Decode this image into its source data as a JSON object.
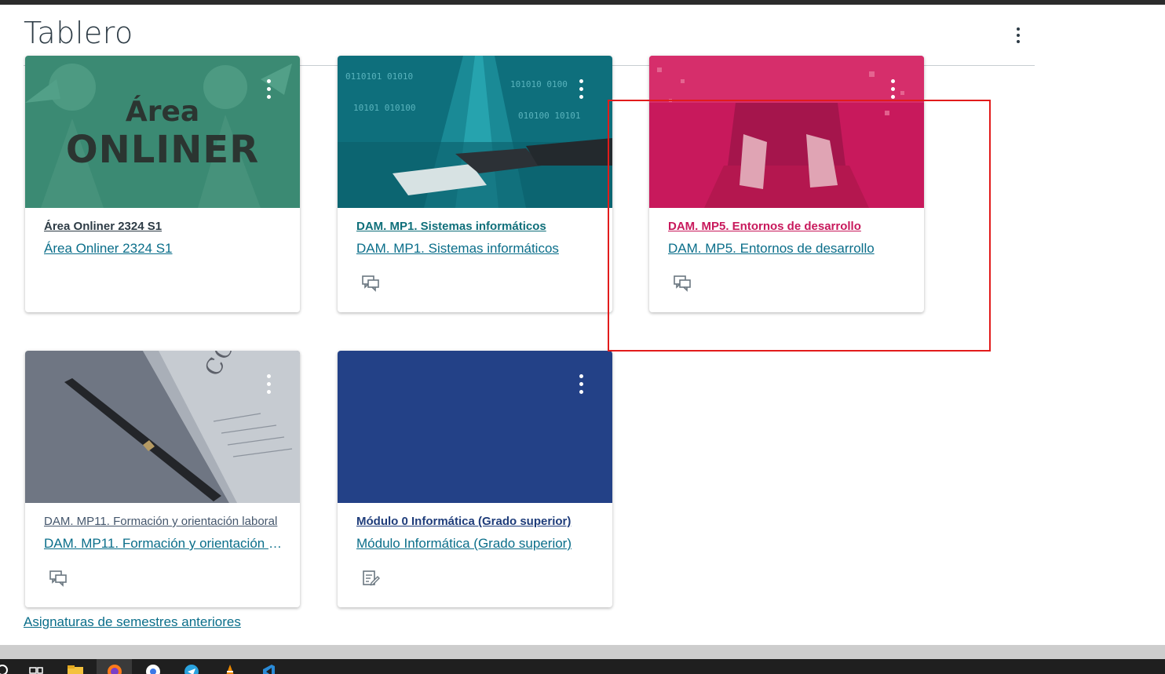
{
  "header": {
    "title": "Tablero"
  },
  "cards": [
    {
      "code": "Área Onliner 2324 S1",
      "name": "Área Onliner 2324 S1",
      "code_color": "#2d3b45",
      "hero_color": "#3b8a73",
      "hero_text_line1": "Área",
      "hero_text_line2": "ONLINER",
      "action_icon": null
    },
    {
      "code": "DAM. MP1. Sistemas informáticos",
      "name": "DAM. MP1. Sistemas informáticos",
      "code_color": "#0f6f7a",
      "hero_color": "#0e6f7c",
      "action_icon": "discussion-icon"
    },
    {
      "code": "DAM. MP5. Entornos de desarrollo",
      "name": "DAM. MP5. Entornos de desarrollo",
      "code_color": "#c8195c",
      "hero_color": "#c8195c",
      "action_icon": "discussion-icon"
    },
    {
      "code": "DAM. MP11. Formación y orientación laboral",
      "name": "DAM. MP11. Formación y orientación laboral",
      "code_color": "#44566c",
      "hero_color": "#6f7683",
      "hero_text": "CONTR",
      "action_icon": "discussion-icon"
    },
    {
      "code": "Módulo 0 Informática (Grado superior)",
      "name": "Módulo Informática (Grado superior)",
      "code_color": "#1e3c7a",
      "hero_color": "#234187",
      "action_icon": "assignment-icon"
    }
  ],
  "links": {
    "previous_semesters": "Asignaturas de semestres anteriores"
  },
  "colors": {
    "link": "#0a6e8a",
    "highlight": "#e21b1b",
    "taskbar": "#1f1f1f"
  },
  "taskbar": {
    "items": [
      "search-icon",
      "task-view-icon",
      "file-explorer-icon",
      "firefox-icon",
      "chrome-icon",
      "telegram-icon",
      "vlc-icon",
      "vscode-icon"
    ]
  }
}
